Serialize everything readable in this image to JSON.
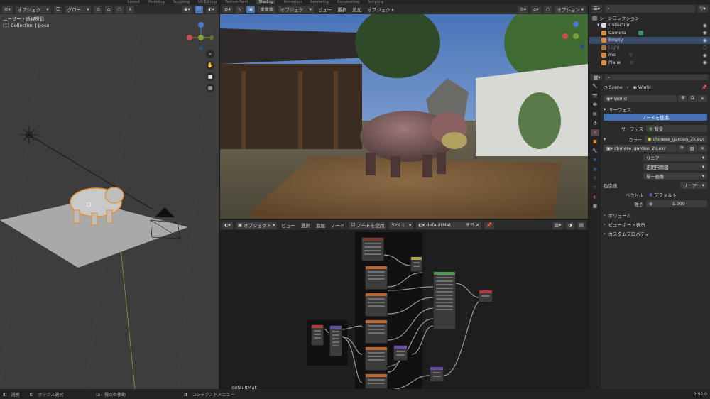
{
  "topbar": {
    "tabs": [
      "Layout",
      "Modeling",
      "Sculpting",
      "UV Editing",
      "Texture Paint",
      "Shading",
      "Animation",
      "Rendering",
      "Compositing",
      "Scripting"
    ],
    "active_tab": "Shading"
  },
  "viewport_left": {
    "mode": "オブジェク...",
    "orientation": "グロー...",
    "line1": "ユーザー・透視投影",
    "line2": "(1) Collection | pose"
  },
  "viewport_render": {
    "mode": "オブジェク...",
    "menus": [
      "ビュー",
      "選択",
      "追加",
      "オブジェクト"
    ],
    "options_label": "オプション"
  },
  "node_editor": {
    "mode": "オブジェクト",
    "menus": [
      "ビュー",
      "選択",
      "追加",
      "ノード"
    ],
    "use_nodes": "ノードを使用",
    "slot": "Slot 1",
    "material": "defaultMat",
    "frame_label": "defaultMat"
  },
  "outliner": {
    "header": "シーンコレクション",
    "items": [
      {
        "label": "Collection",
        "color": "#d9d9d9"
      },
      {
        "label": "Camera",
        "color": "#e08a3c"
      },
      {
        "label": "Empty",
        "color": "#e08a3c"
      },
      {
        "label": "Light",
        "color": "#9a7a4a"
      },
      {
        "label": "me",
        "color": "#e08a3c"
      },
      {
        "label": "Plane",
        "color": "#e08a3c"
      }
    ]
  },
  "properties": {
    "breadcrumb_scene": "Scene",
    "breadcrumb_world": "World",
    "world_name": "World",
    "surface_section": "サーフェス",
    "use_nodes_button": "ノードを使用",
    "surface_label": "サーフェス",
    "surface_value": "背景",
    "color_label": "カラー",
    "color_value": "chinese_garden_2k.exr",
    "image_name": "chinese_garden_2k.exr",
    "interp": "リニア",
    "projection": "正距円筒図",
    "single_image": "単一画像",
    "colorspace_label": "色空間",
    "colorspace_value": "リニア",
    "vector_label": "ベクトル",
    "vector_value": "デフォルト",
    "strength_label": "強さ",
    "strength_value": "1.000",
    "sections": [
      "ボリューム",
      "ビューポート表示",
      "カスタムプロパティ"
    ]
  },
  "status": {
    "select": "選択",
    "box_select": "ボックス選択",
    "rotate": "視点の移動",
    "context": "コンテクストメニュー",
    "version": "2.92.0"
  },
  "colors": {
    "accent": "#4772b3",
    "selected_orange": "#e8902a",
    "node_green": "#4f9a4f",
    "node_orange": "#c0652a",
    "node_red": "#b03a3a",
    "node_purple": "#6a4fa8"
  }
}
